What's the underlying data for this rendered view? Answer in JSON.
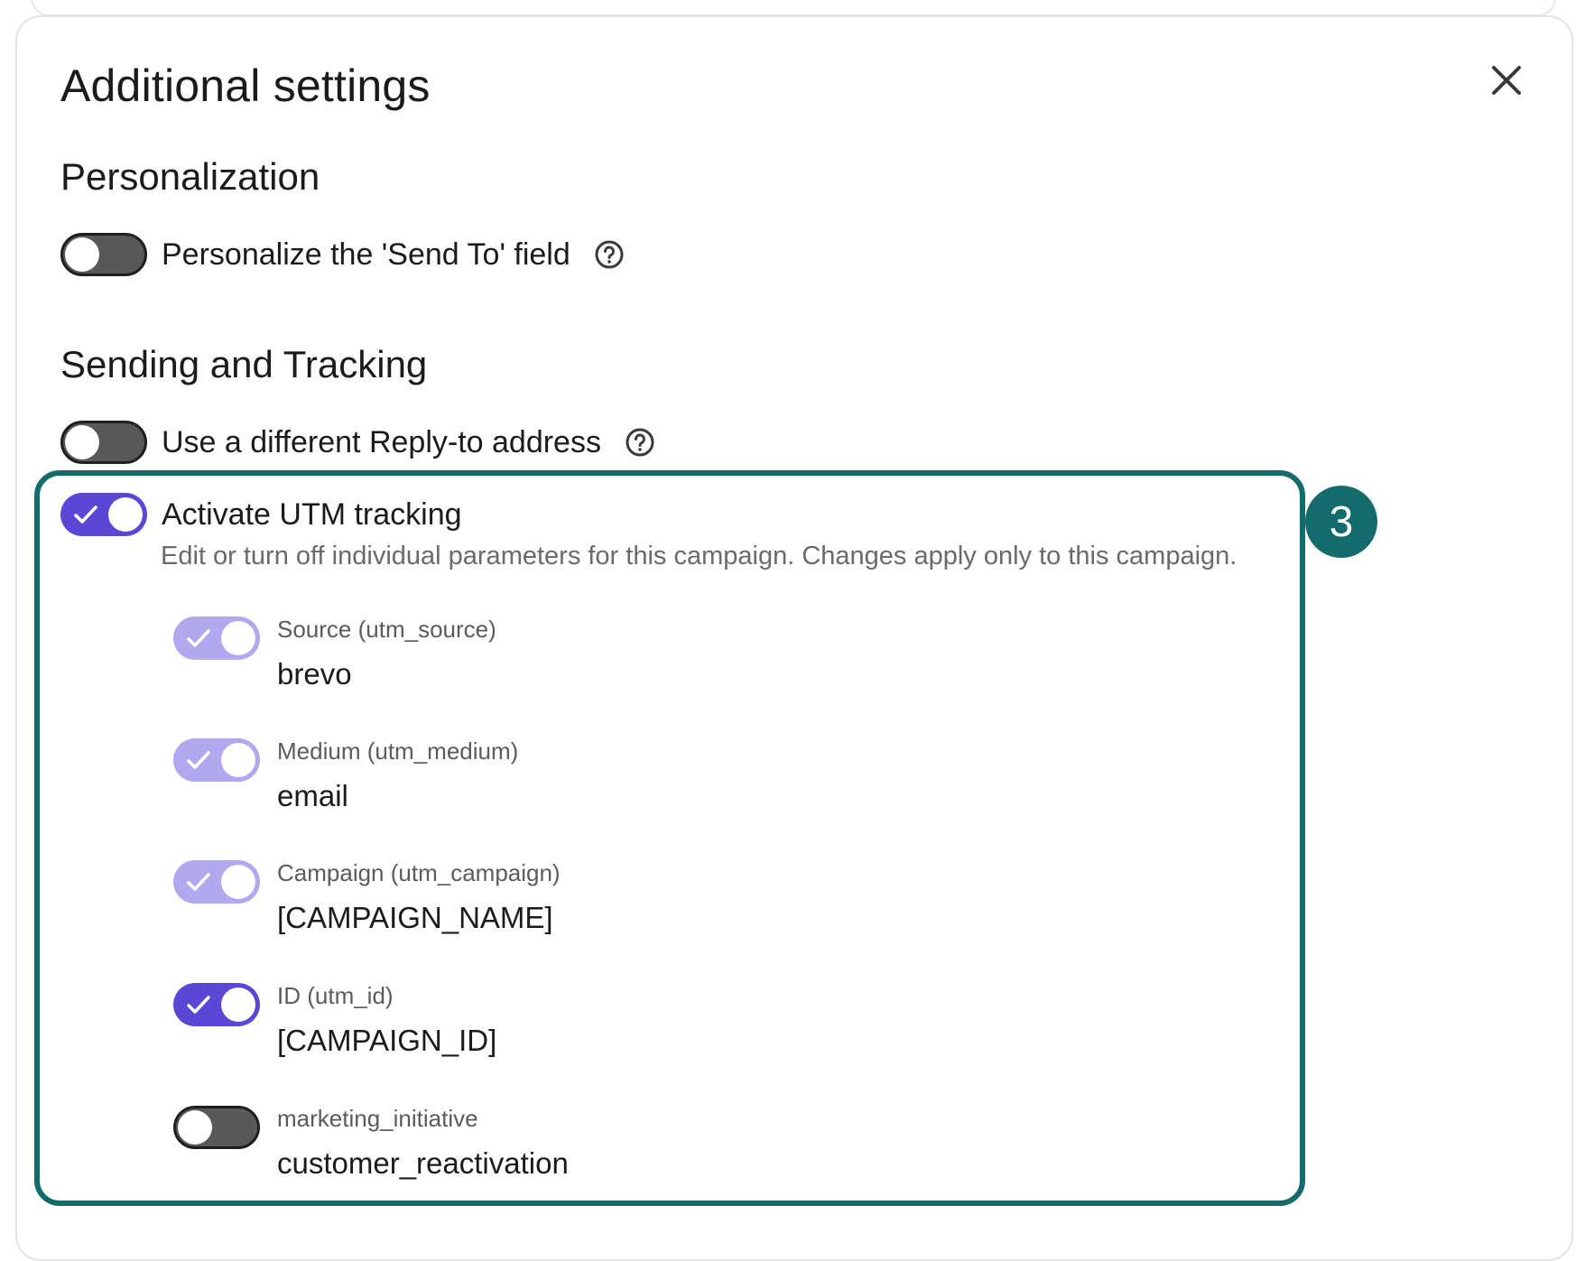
{
  "modal": {
    "title": "Additional settings",
    "close_icon": "close-icon"
  },
  "personalization": {
    "heading": "Personalization",
    "send_to": {
      "label": "Personalize the 'Send To' field",
      "enabled": false
    }
  },
  "sending_tracking": {
    "heading": "Sending and Tracking",
    "reply_to": {
      "label": "Use a different Reply-to address",
      "enabled": false
    },
    "utm": {
      "label": "Activate UTM tracking",
      "enabled": true,
      "description": "Edit or turn off individual parameters for this campaign. Changes apply only to this campaign.",
      "callout_number": "3",
      "params": [
        {
          "label": "Source (utm_source)",
          "value": "brevo",
          "enabled": true,
          "locked": true
        },
        {
          "label": "Medium (utm_medium)",
          "value": "email",
          "enabled": true,
          "locked": true
        },
        {
          "label": "Campaign (utm_campaign)",
          "value": "[CAMPAIGN_NAME]",
          "enabled": true,
          "locked": true
        },
        {
          "label": "ID (utm_id)",
          "value": "[CAMPAIGN_ID]",
          "enabled": true,
          "locked": false
        },
        {
          "label": "marketing_initiative",
          "value": "customer_reactivation",
          "enabled": false,
          "locked": false
        }
      ]
    }
  },
  "colors": {
    "toggle_on": "#5a47d6",
    "toggle_on_locked": "#b1a8ef",
    "toggle_off": "#585858",
    "highlight_frame": "#136b6b"
  }
}
